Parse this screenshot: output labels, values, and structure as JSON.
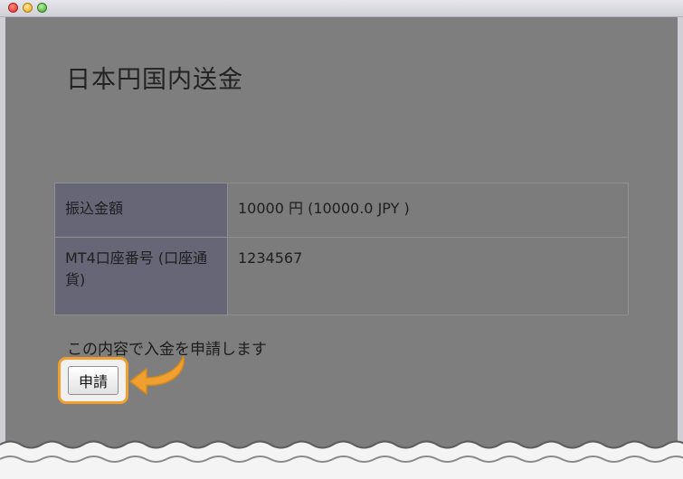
{
  "page": {
    "title": "日本円国内送金"
  },
  "details": {
    "rows": [
      {
        "label": "振込金額",
        "value": "10000 円 (10000.0 JPY )"
      },
      {
        "label": "MT4口座番号 (口座通貨)",
        "value": "1234567"
      }
    ]
  },
  "confirmation": {
    "message": "この内容で入金を申請します",
    "apply_label": "申請"
  },
  "colors": {
    "highlight": "#f0a030"
  }
}
